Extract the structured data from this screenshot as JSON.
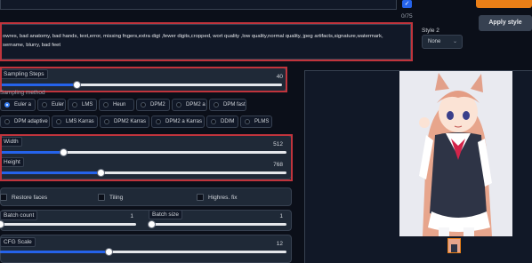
{
  "prompt_counter": "0/75",
  "apply_style_label": "Apply style",
  "style2": {
    "label": "Style 2",
    "value": "None"
  },
  "negative_prompt": {
    "line1": "owres, bad anatomy, bad hands, text,error, missing fngers,extra digt ,fewer digits,cropped, wort quality ,low quality,normal quality, jpeg artifacts,signature,watermark,",
    "line2": "sername, blurry, bad feet"
  },
  "sampling_steps": {
    "label": "Sampling Steps",
    "value": "40",
    "fraction": 0.27
  },
  "sampling_method": {
    "label": "Sampling method",
    "row1": [
      "Euler a",
      "Euler",
      "LMS",
      "Heun",
      "DPM2",
      "DPM2 a",
      "DPM fast"
    ],
    "row2": [
      "DPM adaptive",
      "LMS Karras",
      "DPM2 Karras",
      "DPM2 a Karras",
      "DDIM",
      "PLMS"
    ],
    "selected": "Euler a"
  },
  "width": {
    "label": "Width",
    "value": "512",
    "fraction": 0.22
  },
  "height": {
    "label": "Height",
    "value": "768",
    "fraction": 0.35
  },
  "checkboxes": {
    "restore_faces": "Restore faces",
    "tiling": "Tiling",
    "highres_fix": "Highres. fix"
  },
  "batch_count": {
    "label": "Batch count",
    "value": "1",
    "fraction": 0.0
  },
  "batch_size": {
    "label": "Batch size",
    "value": "1",
    "fraction": 0.0
  },
  "cfg_scale": {
    "label": "CFG Scale",
    "value": "12",
    "fraction": 0.38
  },
  "colors": {
    "accent": "#2563eb",
    "apply_style": "#ea7f17",
    "highlight": "#c0343c",
    "background": "#0b0f19",
    "panel": "#1f2937"
  }
}
